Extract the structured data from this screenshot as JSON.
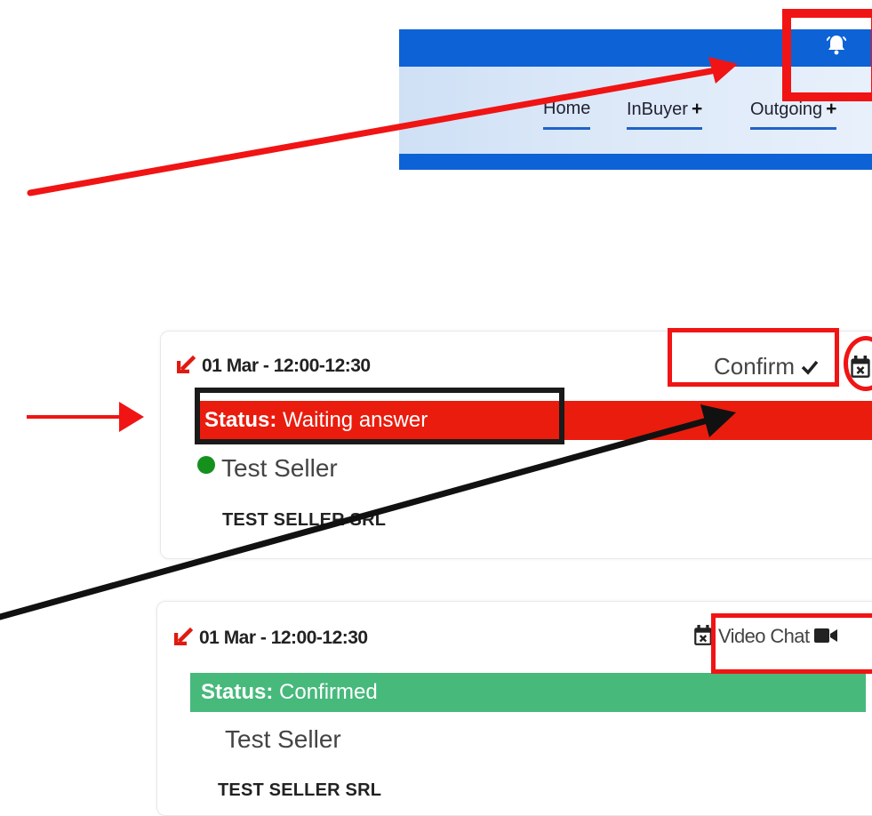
{
  "nav": {
    "items": [
      {
        "label": "Home",
        "has_plus": false
      },
      {
        "label": "InBuyer",
        "has_plus": true
      },
      {
        "label": "Outgoing",
        "has_plus": true
      }
    ],
    "plus_symbol": "+",
    "icons": {
      "notification": "bell-icon"
    },
    "colors": {
      "bar": "#0d62d6",
      "menu_bg": "#dbe8f8",
      "underline": "#1f63c9"
    }
  },
  "meetings": [
    {
      "direction_icon": "arrow-down-left-icon",
      "time": "01 Mar - 12:00-12:30",
      "status_label": "Status:",
      "status_value": "Waiting answer",
      "status_color": "#ea1c0d",
      "online_indicator": "green-dot-icon",
      "seller": "Test Seller",
      "company": "TEST SELLER SRL",
      "action_label": "Confirm",
      "action_icons": [
        "check-icon",
        "calendar-x-icon"
      ]
    },
    {
      "direction_icon": "arrow-down-left-icon",
      "time": "01 Mar - 12:00-12:30",
      "status_label": "Status:",
      "status_value": "Confirmed",
      "status_color": "#46b97b",
      "seller": "Test Seller",
      "company": "TEST SELLER SRL",
      "action_label": "Video Chat",
      "action_icons": [
        "calendar-x-icon",
        "video-camera-icon"
      ]
    }
  ],
  "annotation_colors": {
    "red": "#f01414",
    "black": "#111111"
  }
}
